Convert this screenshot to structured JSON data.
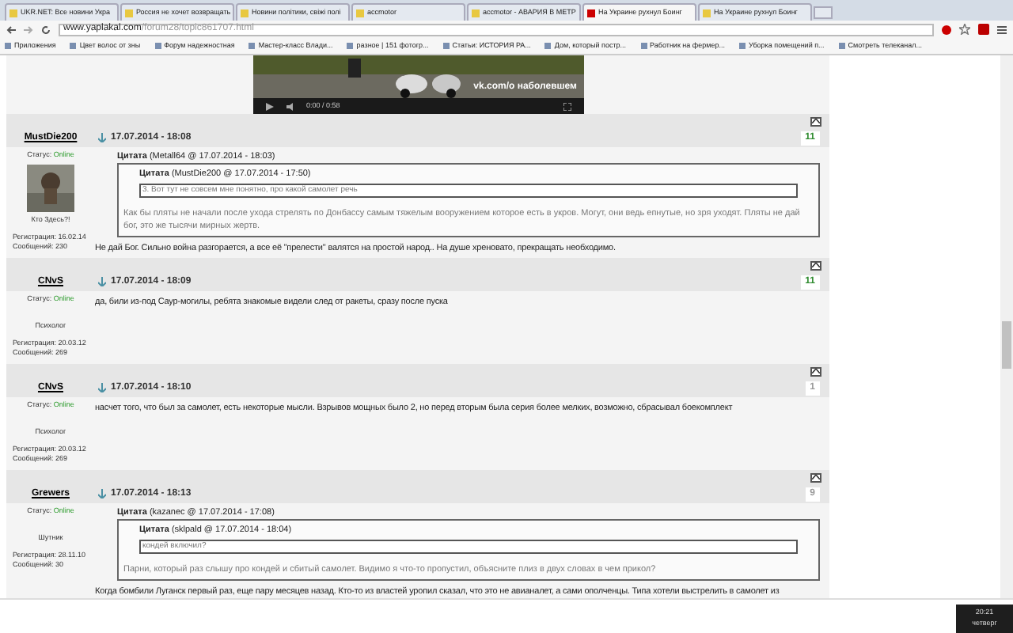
{
  "tabs": [
    {
      "label": "UKR.NET: Все новини Укра",
      "selected": false
    },
    {
      "label": "Россия не хочет возвращать",
      "selected": false
    },
    {
      "label": "Новини політики, свіжі полі",
      "selected": false
    },
    {
      "label": "accmotor",
      "selected": false
    },
    {
      "label": "accmotor - АВАРИЯ В МЕТР",
      "selected": false
    },
    {
      "label": "На Украине рухнул Боинг",
      "selected": true
    },
    {
      "label": "На Украине рухнул Боинг",
      "selected": false
    }
  ],
  "address": {
    "domain": "www.yaplakal.com",
    "path": "/forum28/topic861707.html"
  },
  "bookmarks": [
    "Приложения",
    "Цвет волос от зны",
    "Форум надежностная",
    "Мастер-класс Влади...",
    "разное | 151 фотогр...",
    "Статьи: ИСТОРИЯ РА...",
    "Дом, который постр...",
    "Работник на фермер...",
    "Уборка помещений п...",
    "Смотреть телеканал..."
  ],
  "video": {
    "time": "0:00 / 0:58",
    "caption": "vk.com/о наболевшем"
  },
  "posts": [
    {
      "author": "MustDie200",
      "status_label": "Статус:",
      "status": "Online",
      "avatar": true,
      "rank": "Кто Здесь?!",
      "registered": "Регистрация: 16.02.14",
      "messages": "Сообщений: 230",
      "date": "17.07.2014 - 18:08",
      "rating": "11",
      "color": "#2e8b2e",
      "quote": {
        "header": "Цитата",
        "source": "(Metall64 @ 17.07.2014 - 18:03)",
        "inner_header": "Цитата",
        "inner_source": "(MustDie200 @ 17.07.2014 - 17:50)",
        "inner_text": "3. Вот тут не совсем мне понятно, про какой самолет речь",
        "text": "Как бы пляты не начали после ухода стрелять по Донбассу самым тяжелым вооружением которое есть в укров. Могут, они ведь епнутые, но зря уходят. Пляты не дай бог, это же тысячи мирных жертв."
      },
      "body": "Не дай Бог. Сильно война разгорается, а все её \"прелести\" валятся на простой народ.. На душе хреновато, прекращать необходимо."
    },
    {
      "author": "CNvS",
      "status_label": "Статус:",
      "status": "Online",
      "avatar": false,
      "rank": "Психолог",
      "registered": "Регистрация: 20.03.12",
      "messages": "Сообщений: 269",
      "date": "17.07.2014 - 18:09",
      "rating": "11",
      "color": "#2e8b2e",
      "body": "да, били из-под Саур-могилы, ребята знакомые видели след от ракеты, сразу после пуска"
    },
    {
      "author": "CNvS",
      "status_label": "Статус:",
      "status": "Online",
      "avatar": false,
      "rank": "Психолог",
      "registered": "Регистрация: 20.03.12",
      "messages": "Сообщений: 269",
      "date": "17.07.2014 - 18:10",
      "rating": "1",
      "color": "#999999",
      "body": "насчет того, что был за самолет, есть некоторые мысли. Взрывов мощных было 2, но перед вторым была серия более мелких, возможно, сбрасывал боекомплект"
    },
    {
      "author": "Grewers",
      "status_label": "Статус:",
      "status": "Online",
      "avatar": false,
      "rank": "Шутник",
      "registered": "Регистрация: 28.11.10",
      "messages": "Сообщений: 30",
      "date": "17.07.2014 - 18:13",
      "rating": "9",
      "color": "#999999",
      "quote": {
        "header": "Цитата",
        "source": "(kazanec @ 17.07.2014 - 17:08)",
        "inner_header": "Цитата",
        "inner_source": "(sklpald @ 17.07.2014 - 18:04)",
        "inner_text": "кондей включил?",
        "text": "Парни, который раз слышу про кондей и сбитый самолет. Видимо я что-то пропустил, объясните плиз в двух словах в чем прикол?"
      },
      "body": "Когда бомбили Луганск первый раз, еще пару месяцев назад. Кто-то из властей уропил сказал, что это не авианалет, а сами ополченцы. Типа хотели выстрелить в самолет из"
    }
  ],
  "clock": {
    "time": "20:21",
    "day": "четверг"
  }
}
